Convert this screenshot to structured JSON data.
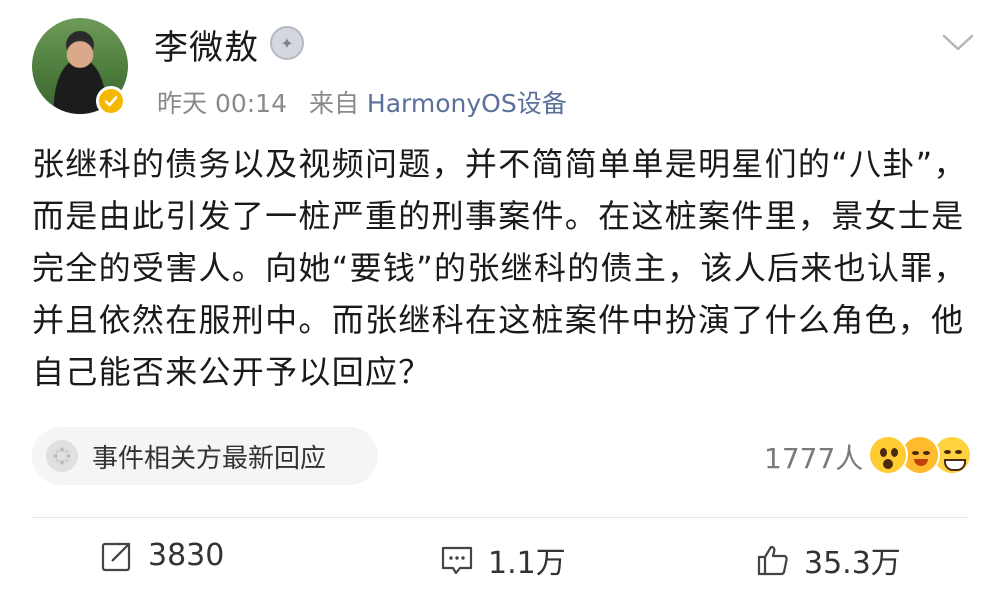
{
  "post": {
    "author": "李微敖",
    "time": "昨天 00:14",
    "source_prefix": "来自",
    "source": "HarmonyOS设备",
    "text": "张继科的债务以及视频问题，并不简简单单是明星们的“八卦”，而是由此引发了一桩严重的刑事案件。在这桩案件里，景女士是完全的受害人。向她“要钱”的张继科的债主，该人后来也认罪，并且依然在服刑中。而张继科在这桩案件中扮演了什么角色，他自己能否来公开予以回应？"
  },
  "topic": {
    "label": "事件相关方最新回应"
  },
  "reactions": {
    "count": "1777人"
  },
  "actions": {
    "repost": "3830",
    "comment": "1.1万",
    "like": "35.3万"
  },
  "icons": [
    "avatar",
    "verified-badge-icon",
    "medal-icon",
    "chevron-down-icon",
    "topic-dots-icon",
    "emoji-surprised-icon",
    "emoji-laugh-icon",
    "emoji-grin-icon",
    "repost-icon",
    "comment-icon",
    "like-icon"
  ],
  "colors": {
    "source": "#5b6f99",
    "verify": "#f5b800",
    "meta": "#8a8a8a"
  }
}
